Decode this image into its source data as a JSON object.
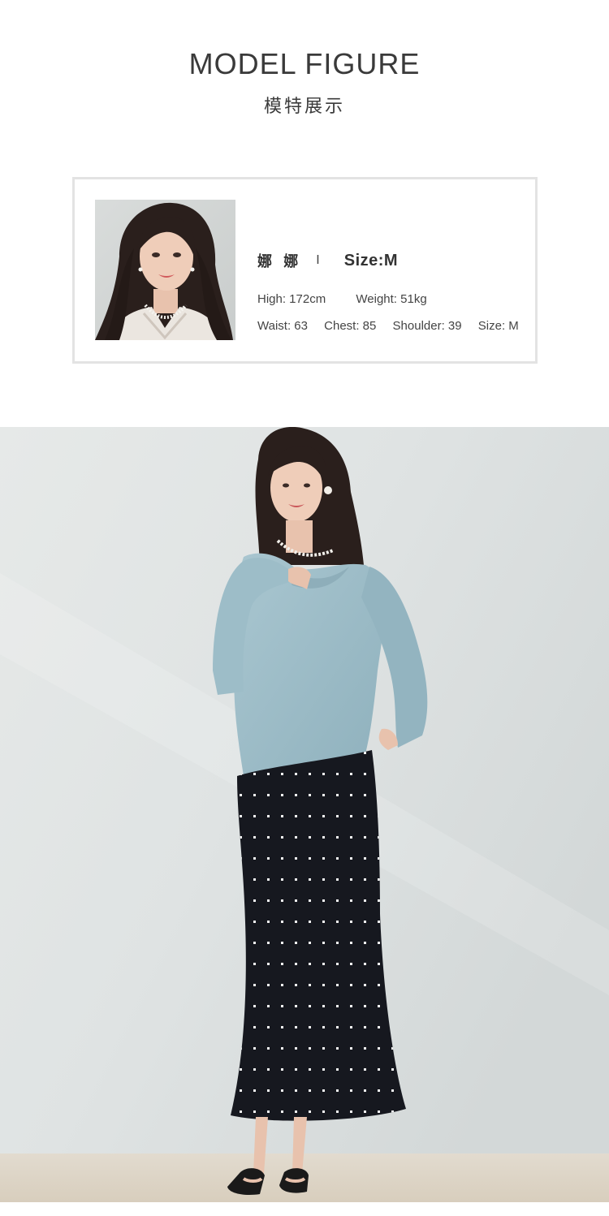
{
  "header": {
    "title": "MODEL FIGURE",
    "subtitle": "模特展示"
  },
  "model_card": {
    "name": "娜 娜",
    "separator": "I",
    "size_heading": "Size:M",
    "high": "High: 172cm",
    "weight": "Weight: 51kg",
    "waist": "Waist: 63",
    "chest": "Chest: 85",
    "shoulder": "Shoulder: 39",
    "size": "Size: M"
  },
  "colors": {
    "top": "#9fbfca",
    "skirt": "#16181f",
    "wall": "#e2e6e6",
    "floor": "#dcd3c4"
  }
}
